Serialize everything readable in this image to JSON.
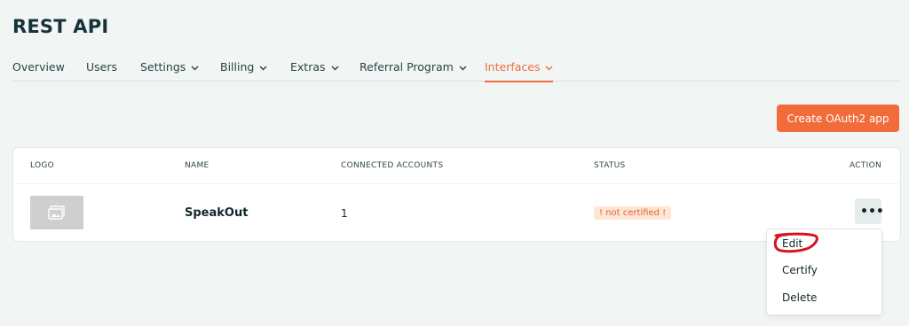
{
  "header": {
    "title": "REST API"
  },
  "tabs": [
    {
      "label": "Overview"
    },
    {
      "label": "Users"
    },
    {
      "label": "Settings"
    },
    {
      "label": "Billing"
    },
    {
      "label": "Extras"
    },
    {
      "label": "Referral Program"
    },
    {
      "label": "Interfaces",
      "active": true
    }
  ],
  "toolbar": {
    "create_label": "Create OAuth2 app"
  },
  "table": {
    "headers": [
      "LOGO",
      "NAME",
      "CONNECTED ACCOUNTS",
      "STATUS",
      "ACTION"
    ],
    "rows": [
      {
        "logo": "image-placeholder-icon",
        "name": "SpeakOut",
        "connected_accounts": "1",
        "status": "! not certified !",
        "action": "•••"
      }
    ]
  },
  "menu": {
    "items": [
      "Edit",
      "Certify",
      "Delete"
    ]
  },
  "colors": {
    "accent": "#f26b3a",
    "status_bg": "#fde6d6",
    "background": "#f1f6f5",
    "annotation": "#d8141e"
  }
}
